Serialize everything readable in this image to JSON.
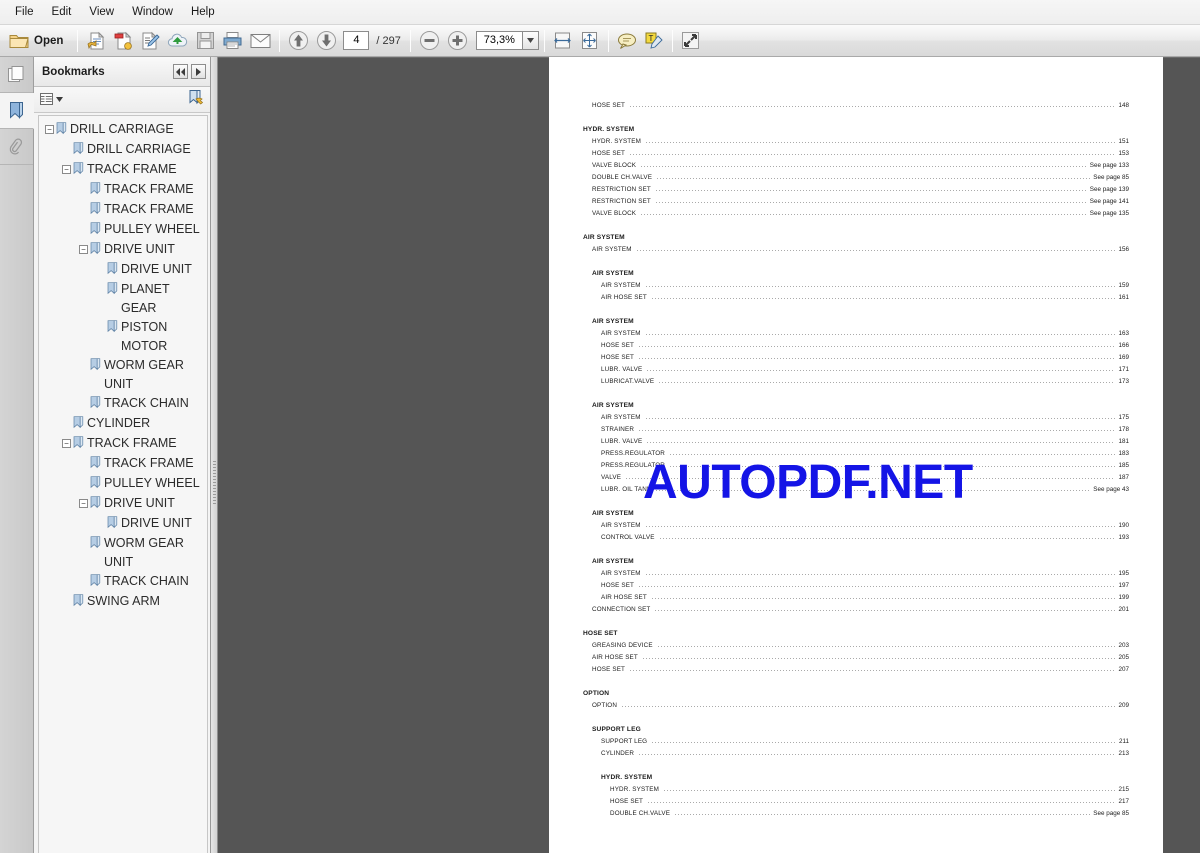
{
  "menu": {
    "items": [
      {
        "label": "File"
      },
      {
        "label": "Edit"
      },
      {
        "label": "View"
      },
      {
        "label": "Window"
      },
      {
        "label": "Help"
      }
    ]
  },
  "toolbar": {
    "open_label": "Open",
    "open_icon": "folder-icon",
    "buttons": [
      {
        "name": "open-from-web-icon",
        "label": ""
      },
      {
        "name": "create-pdf-icon",
        "label": ""
      },
      {
        "name": "edit-pdf-icon",
        "label": ""
      },
      {
        "name": "upload-cloud-icon",
        "label": ""
      },
      {
        "name": "save-icon",
        "label": ""
      },
      {
        "name": "print-icon",
        "label": ""
      },
      {
        "name": "email-icon",
        "label": ""
      }
    ],
    "prev_page_icon": "arrow-up-icon",
    "next_page_icon": "arrow-down-icon",
    "current_page": "4",
    "total_pages": "/ 297",
    "zoom_out_icon": "minus-circle-icon",
    "zoom_in_icon": "plus-circle-icon",
    "zoom_value": "73,3%",
    "zoom_dropdown_icon": "chevron-down-icon",
    "fit_width_icon": "fit-width-icon",
    "fit_page_icon": "fit-page-icon",
    "comment_icon": "comment-balloon-icon",
    "highlight_icon": "highlight-text-icon",
    "fullscreen_icon": "fullscreen-icon"
  },
  "rail": {
    "tabs": [
      {
        "name": "pages-thumbnail-tab",
        "icon": "pages-icon",
        "active": false
      },
      {
        "name": "bookmarks-tab",
        "icon": "bookmark-icon",
        "active": true
      },
      {
        "name": "attachments-tab",
        "icon": "paperclip-icon",
        "active": false
      }
    ]
  },
  "bookmarks_panel": {
    "title": "Bookmarks",
    "collapse_icon": "double-chevron-left-icon",
    "expand_icon": "chevron-right-icon",
    "options_icon": "list-options-icon",
    "options_caret_icon": "caret-down-icon",
    "new_bookmark_icon": "new-bookmark-icon",
    "tree": [
      {
        "label": "DRILL CARRIAGE",
        "level": 0,
        "toggle": "minus"
      },
      {
        "label": "DRILL CARRIAGE",
        "level": 1,
        "toggle": "none"
      },
      {
        "label": "TRACK FRAME",
        "level": 1,
        "toggle": "minus"
      },
      {
        "label": "TRACK FRAME",
        "level": 2,
        "toggle": "none"
      },
      {
        "label": "TRACK FRAME",
        "level": 2,
        "toggle": "none"
      },
      {
        "label": "PULLEY WHEEL",
        "level": 2,
        "toggle": "none"
      },
      {
        "label": "DRIVE UNIT",
        "level": 2,
        "toggle": "minus"
      },
      {
        "label": "DRIVE UNIT",
        "level": 3,
        "toggle": "none"
      },
      {
        "label": "PLANET GEAR",
        "level": 3,
        "toggle": "none"
      },
      {
        "label": "PISTON MOTOR",
        "level": 3,
        "toggle": "none"
      },
      {
        "label": "WORM GEAR UNIT",
        "level": 2,
        "toggle": "none"
      },
      {
        "label": "TRACK CHAIN",
        "level": 2,
        "toggle": "none"
      },
      {
        "label": "CYLINDER",
        "level": 1,
        "toggle": "none"
      },
      {
        "label": "TRACK FRAME",
        "level": 1,
        "toggle": "minus"
      },
      {
        "label": "TRACK FRAME",
        "level": 2,
        "toggle": "none"
      },
      {
        "label": "PULLEY WHEEL",
        "level": 2,
        "toggle": "none"
      },
      {
        "label": "DRIVE UNIT",
        "level": 2,
        "toggle": "minus"
      },
      {
        "label": "DRIVE UNIT",
        "level": 3,
        "toggle": "none"
      },
      {
        "label": "WORM GEAR UNIT",
        "level": 2,
        "toggle": "none"
      },
      {
        "label": "TRACK CHAIN",
        "level": 2,
        "toggle": "none"
      },
      {
        "label": "SWING ARM",
        "level": 1,
        "toggle": "none"
      }
    ]
  },
  "document": {
    "watermark": "AUTOPDF.NET",
    "watermark_color": "#1414e6",
    "toc": [
      {
        "type": "entry",
        "indent": 1,
        "title": "HOSE SET",
        "page": "148"
      },
      {
        "type": "gap"
      },
      {
        "type": "head",
        "indent": 0,
        "title": "HYDR. SYSTEM"
      },
      {
        "type": "entry",
        "indent": 1,
        "title": "HYDR. SYSTEM",
        "page": "151"
      },
      {
        "type": "entry",
        "indent": 1,
        "title": "HOSE SET",
        "page": "153"
      },
      {
        "type": "entry",
        "indent": 1,
        "title": "VALVE BLOCK",
        "page": "See page 133"
      },
      {
        "type": "entry",
        "indent": 1,
        "title": "DOUBLE CH.VALVE",
        "page": "See page 85"
      },
      {
        "type": "entry",
        "indent": 1,
        "title": "RESTRICTION SET",
        "page": "See page 139"
      },
      {
        "type": "entry",
        "indent": 1,
        "title": "RESTRICTION SET",
        "page": "See page 141"
      },
      {
        "type": "entry",
        "indent": 1,
        "title": "VALVE BLOCK",
        "page": "See page 135"
      },
      {
        "type": "gap"
      },
      {
        "type": "head",
        "indent": 0,
        "title": "AIR SYSTEM"
      },
      {
        "type": "entry",
        "indent": 1,
        "title": "AIR SYSTEM",
        "page": "156"
      },
      {
        "type": "gap"
      },
      {
        "type": "head",
        "indent": 1,
        "title": "AIR SYSTEM"
      },
      {
        "type": "entry",
        "indent": 2,
        "title": "AIR SYSTEM",
        "page": "159"
      },
      {
        "type": "entry",
        "indent": 2,
        "title": "AIR HOSE SET",
        "page": "161"
      },
      {
        "type": "gap"
      },
      {
        "type": "head",
        "indent": 1,
        "title": "AIR SYSTEM"
      },
      {
        "type": "entry",
        "indent": 2,
        "title": "AIR SYSTEM",
        "page": "163"
      },
      {
        "type": "entry",
        "indent": 2,
        "title": "HOSE SET",
        "page": "166"
      },
      {
        "type": "entry",
        "indent": 2,
        "title": "HOSE SET",
        "page": "169"
      },
      {
        "type": "entry",
        "indent": 2,
        "title": "LUBR. VALVE",
        "page": "171"
      },
      {
        "type": "entry",
        "indent": 2,
        "title": "LUBRICAT.VALVE",
        "page": "173"
      },
      {
        "type": "gap"
      },
      {
        "type": "head",
        "indent": 1,
        "title": "AIR SYSTEM"
      },
      {
        "type": "entry",
        "indent": 2,
        "title": "AIR SYSTEM",
        "page": "175"
      },
      {
        "type": "entry",
        "indent": 2,
        "title": "STRAINER",
        "page": "178"
      },
      {
        "type": "entry",
        "indent": 2,
        "title": "LUBR. VALVE",
        "page": "181"
      },
      {
        "type": "entry",
        "indent": 2,
        "title": "PRESS.REGULATOR",
        "page": "183"
      },
      {
        "type": "entry",
        "indent": 2,
        "title": "PRESS.REGULATOR",
        "page": "185"
      },
      {
        "type": "entry",
        "indent": 2,
        "title": "VALVE",
        "page": "187"
      },
      {
        "type": "entry",
        "indent": 2,
        "title": "LUBR. OIL TANK",
        "page": "See page 43"
      },
      {
        "type": "gap"
      },
      {
        "type": "head",
        "indent": 1,
        "title": "AIR SYSTEM"
      },
      {
        "type": "entry",
        "indent": 2,
        "title": "AIR SYSTEM",
        "page": "190"
      },
      {
        "type": "entry",
        "indent": 2,
        "title": "CONTROL VALVE",
        "page": "193"
      },
      {
        "type": "gap"
      },
      {
        "type": "head",
        "indent": 1,
        "title": "AIR SYSTEM"
      },
      {
        "type": "entry",
        "indent": 2,
        "title": "AIR SYSTEM",
        "page": "195"
      },
      {
        "type": "entry",
        "indent": 2,
        "title": "HOSE SET",
        "page": "197"
      },
      {
        "type": "entry",
        "indent": 2,
        "title": "AIR HOSE SET",
        "page": "199"
      },
      {
        "type": "entry",
        "indent": 1,
        "title": "CONNECTION SET",
        "page": "201"
      },
      {
        "type": "gap"
      },
      {
        "type": "head",
        "indent": 0,
        "title": "HOSE SET"
      },
      {
        "type": "entry",
        "indent": 1,
        "title": "GREASING DEVICE",
        "page": "203"
      },
      {
        "type": "entry",
        "indent": 1,
        "title": "AIR HOSE SET",
        "page": "205"
      },
      {
        "type": "entry",
        "indent": 1,
        "title": "HOSE SET",
        "page": "207"
      },
      {
        "type": "gap"
      },
      {
        "type": "head",
        "indent": 0,
        "title": "OPTION"
      },
      {
        "type": "entry",
        "indent": 1,
        "title": "OPTION",
        "page": "209"
      },
      {
        "type": "gap"
      },
      {
        "type": "head",
        "indent": 1,
        "title": "SUPPORT LEG"
      },
      {
        "type": "entry",
        "indent": 2,
        "title": "SUPPORT LEG",
        "page": "211"
      },
      {
        "type": "entry",
        "indent": 2,
        "title": "CYLINDER",
        "page": "213"
      },
      {
        "type": "gap"
      },
      {
        "type": "head",
        "indent": 2,
        "title": "HYDR. SYSTEM"
      },
      {
        "type": "entry",
        "indent": 3,
        "title": "HYDR. SYSTEM",
        "page": "215"
      },
      {
        "type": "entry",
        "indent": 3,
        "title": "HOSE SET",
        "page": "217"
      },
      {
        "type": "entry",
        "indent": 3,
        "title": "DOUBLE CH.VALVE",
        "page": "See page 85"
      }
    ]
  }
}
